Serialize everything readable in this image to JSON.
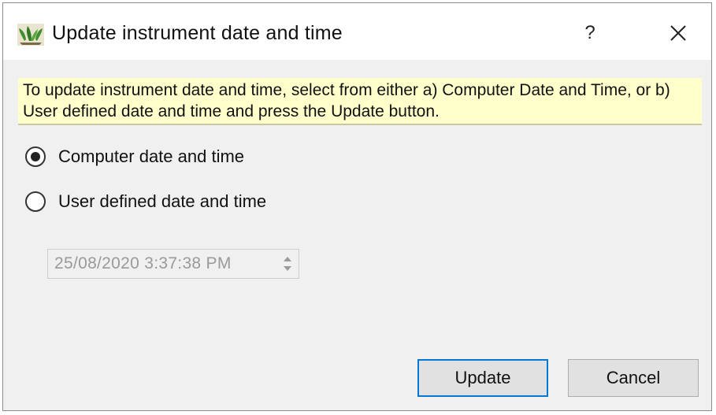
{
  "window": {
    "title": "Update instrument date and time",
    "help_label": "?",
    "icons": {
      "app": "plant-app-icon",
      "close": "close-icon"
    }
  },
  "info_text": "To update instrument date and time, select from either a) Computer Date and Time, or b) User defined date and time and press the Update button.",
  "options": [
    {
      "label": "Computer date and time",
      "selected": true
    },
    {
      "label": "User defined date and time",
      "selected": false
    }
  ],
  "datetime": {
    "value": "25/08/2020 3:37:38 PM",
    "enabled": false
  },
  "buttons": {
    "update": "Update",
    "cancel": "Cancel"
  },
  "colors": {
    "info_bg": "#ffffcc",
    "default_button_border": "#0078d7",
    "dialog_bg": "#f0f0f0"
  }
}
